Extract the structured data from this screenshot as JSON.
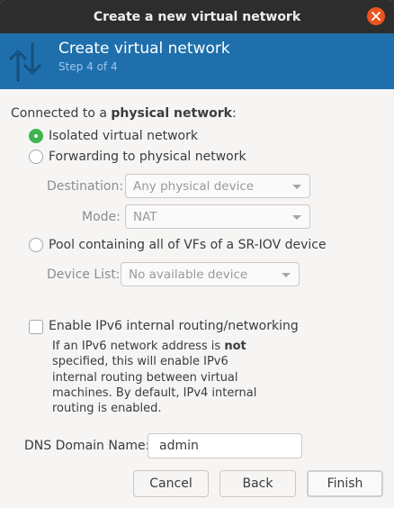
{
  "window": {
    "title": "Create a new virtual network"
  },
  "banner": {
    "title": "Create virtual network",
    "step": "Step 4 of 4"
  },
  "connected": {
    "prefix": "Connected to a ",
    "bold": "physical network",
    "suffix": ":"
  },
  "options": {
    "isolated": {
      "label": "Isolated virtual network",
      "selected": true
    },
    "forwarding": {
      "label": "Forwarding to physical network",
      "selected": false
    },
    "pool": {
      "label": "Pool containing all of VFs of a SR-IOV device",
      "selected": false
    }
  },
  "forwarding": {
    "destination_label": "Destination:",
    "destination_value": "Any physical device",
    "mode_label": "Mode:",
    "mode_value": "NAT"
  },
  "pool": {
    "device_list_label": "Device List:",
    "device_list_value": "No available device"
  },
  "ipv6": {
    "label": "Enable IPv6 internal routing/networking",
    "checked": false,
    "desc_part1": "If an IPv6 network address is ",
    "desc_bold": "not",
    "desc_part2": " specified, this will enable IPv6 internal routing between virtual machines.  By default, IPv4 internal routing is enabled."
  },
  "dns": {
    "label": "DNS Domain Name:",
    "value": "admin"
  },
  "buttons": {
    "cancel": "Cancel",
    "back": "Back",
    "finish": "Finish"
  },
  "colors": {
    "banner": "#1f6fad",
    "accent": "#e95420",
    "radio_selected": "#3eb34f"
  }
}
